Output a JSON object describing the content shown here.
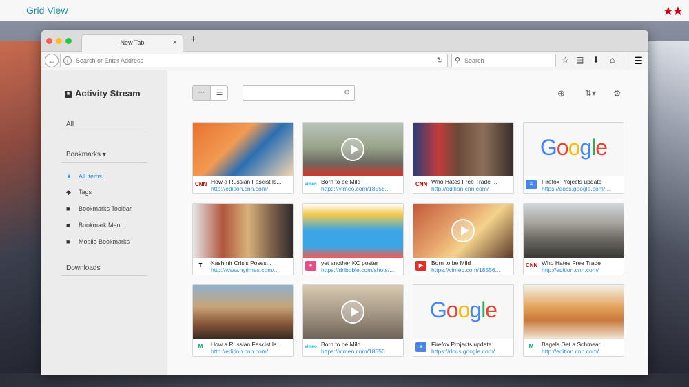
{
  "header": {
    "title": "Grid View",
    "stars": "★★"
  },
  "browser": {
    "tab_title": "New Tab",
    "tab_close": "×",
    "new_tab": "+",
    "url_placeholder": "Search or Enter Address",
    "search_placeholder": "Search"
  },
  "sidebar": {
    "title": "Activity Stream",
    "all": "All",
    "bookmarks": "Bookmarks",
    "items": [
      {
        "label": "All items",
        "icon": "star-icon",
        "active": true
      },
      {
        "label": "Tags",
        "icon": "tag-icon"
      },
      {
        "label": "Bookmarks Toolbar",
        "icon": "folder-icon"
      },
      {
        "label": "Bookmark Menu",
        "icon": "folder-icon"
      },
      {
        "label": "Mobile Bookmarks",
        "icon": "folder-icon"
      }
    ],
    "downloads": "Downloads"
  },
  "cards": [
    {
      "title": "How a Russian Fascist Is...",
      "url": "http://edition.cnn.com/",
      "source": "CNN",
      "thumb": "bear"
    },
    {
      "title": "Born to be Mild",
      "url": "https://vimeo.com/18556...",
      "source": "vimeo",
      "thumb": "video-road"
    },
    {
      "title": "Who Hates Free Trade ...",
      "url": "http://edition.cnn.com/",
      "source": "CNN",
      "thumb": "portrait"
    },
    {
      "title": "Firefox Projects update",
      "url": "https://docs.google.com/...",
      "source": "docs",
      "thumb": "google"
    },
    {
      "title": "Kashmir Crisis Poses...",
      "url": "http://www.nytimes.com/...",
      "source": "NYT",
      "thumb": "crowd"
    },
    {
      "title": "yet another KC poster",
      "url": "https://dribbble.com/shots/...",
      "source": "dribbble",
      "thumb": "poster"
    },
    {
      "title": "Born to be Mild",
      "url": "https://vimeo.com/18556...",
      "source": "YouTube",
      "thumb": "video-cake"
    },
    {
      "title": "Who Hates Free Trade",
      "url": "http://edition.cnn.com/",
      "source": "CNN",
      "thumb": "street"
    },
    {
      "title": "How a Russian Fascist Is...",
      "url": "http://edition.cnn.com/",
      "source": "medium",
      "thumb": "people"
    },
    {
      "title": "Born to be Mild",
      "url": "https://vimeo.com/18556...",
      "source": "vimeo",
      "thumb": "video-skate"
    },
    {
      "title": "Firefox Projects update",
      "url": "https://docs.google.com/...",
      "source": "docs",
      "thumb": "google"
    },
    {
      "title": "Bagels Get a Schmear,",
      "url": "http://edition.cnn.com/",
      "source": "medium",
      "thumb": "bagels"
    }
  ],
  "colors": {
    "accent": "#2c8ee0",
    "title": "#1f8fa5",
    "stars": "#d0021b"
  }
}
